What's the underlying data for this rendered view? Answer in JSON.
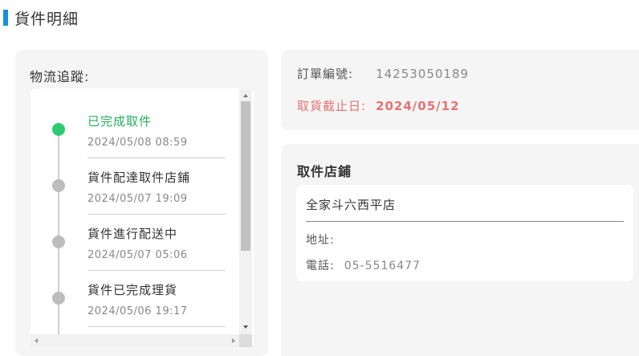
{
  "header": {
    "title": "貨件明細",
    "accent_color": "#1a8fdc"
  },
  "logistics": {
    "label": "物流追蹤:",
    "events": [
      {
        "title": "已完成取件",
        "time": "2024/05/08  08:59",
        "active": true
      },
      {
        "title": "貨件配達取件店鋪",
        "time": "2024/05/07  19:09",
        "active": false
      },
      {
        "title": "貨件進行配送中",
        "time": "2024/05/07  05:06",
        "active": false
      },
      {
        "title": "貨件已完成理貨",
        "time": "2024/05/06  19:17",
        "active": false
      }
    ],
    "active_color": "#2ecc71"
  },
  "order": {
    "number_label": "訂單編號:",
    "number_value": "14253050189",
    "deadline_label": "取貨截止日:",
    "deadline_value": "2024/05/12",
    "deadline_color": "#e57373"
  },
  "store": {
    "label": "取件店鋪",
    "name": "全家斗六西平店",
    "address_label": "地址:",
    "address_value": "",
    "phone_label": "電話:",
    "phone_value": "05-5516477"
  }
}
